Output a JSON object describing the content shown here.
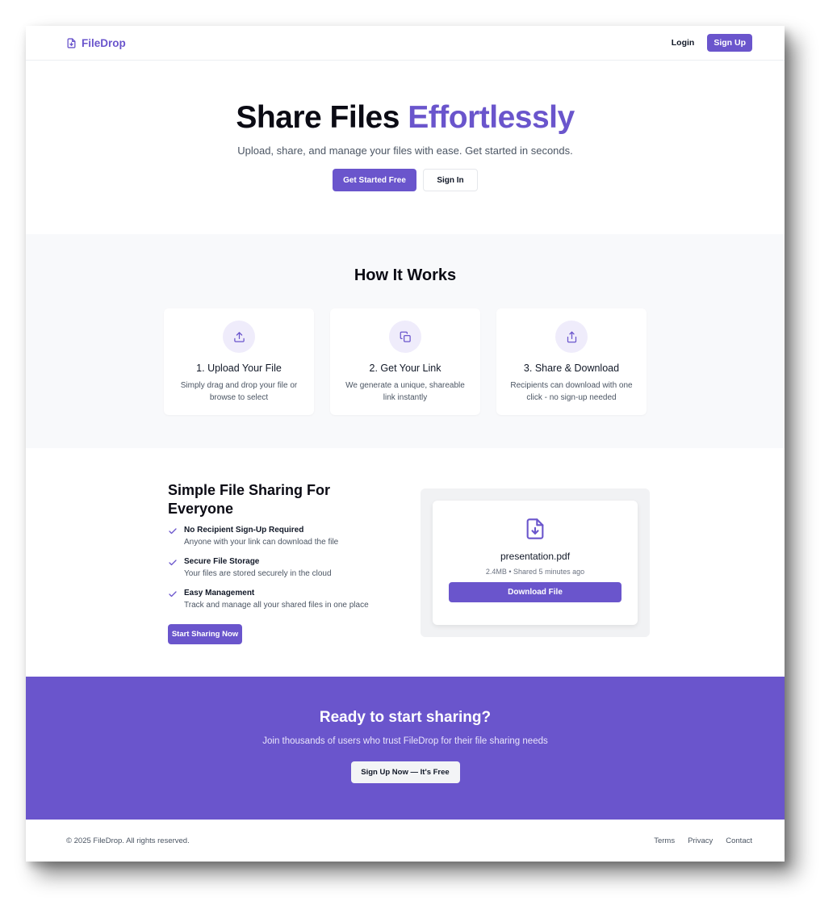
{
  "header": {
    "brand": "FileDrop",
    "login_label": "Login",
    "signup_label": "Sign Up"
  },
  "hero": {
    "title_main": "Share Files ",
    "title_accent": "Effortlessly",
    "subtitle": "Upload, share, and manage your files with ease. Get started in seconds.",
    "primary_cta": "Get Started Free",
    "secondary_cta": "Sign In"
  },
  "how": {
    "title": "How It Works",
    "steps": [
      {
        "icon": "upload-icon",
        "title": "1. Upload Your File",
        "desc": "Simply drag and drop your file or browse to select"
      },
      {
        "icon": "copy-icon",
        "title": "2. Get Your Link",
        "desc": "We generate a unique, shareable link instantly"
      },
      {
        "icon": "share-icon",
        "title": "3. Share & Download",
        "desc": "Recipients can download with one click - no sign-up needed"
      }
    ]
  },
  "features": {
    "title": "Simple File Sharing For Everyone",
    "items": [
      {
        "title": "No Recipient Sign-Up Required",
        "desc": "Anyone with your link can download the file"
      },
      {
        "title": "Secure File Storage",
        "desc": "Your files are stored securely in the cloud"
      },
      {
        "title": "Easy Management",
        "desc": "Track and manage all your shared files in one place"
      }
    ],
    "cta": "Start Sharing Now"
  },
  "preview": {
    "icon": "file-download-icon",
    "file_name": "presentation.pdf",
    "meta": "2.4MB • Shared 5 minutes ago",
    "button": "Download File"
  },
  "cta": {
    "title": "Ready to start sharing?",
    "subtitle": "Join thousands of users who trust FileDrop for their file sharing needs",
    "button": "Sign Up Now — It's Free"
  },
  "footer": {
    "copyright": "© 2025 FileDrop. All rights reserved.",
    "links": [
      "Terms",
      "Privacy",
      "Contact"
    ]
  },
  "colors": {
    "accent": "#6a55cc",
    "icon_bg": "#efecfb",
    "section_bg": "#f8f9fb"
  }
}
